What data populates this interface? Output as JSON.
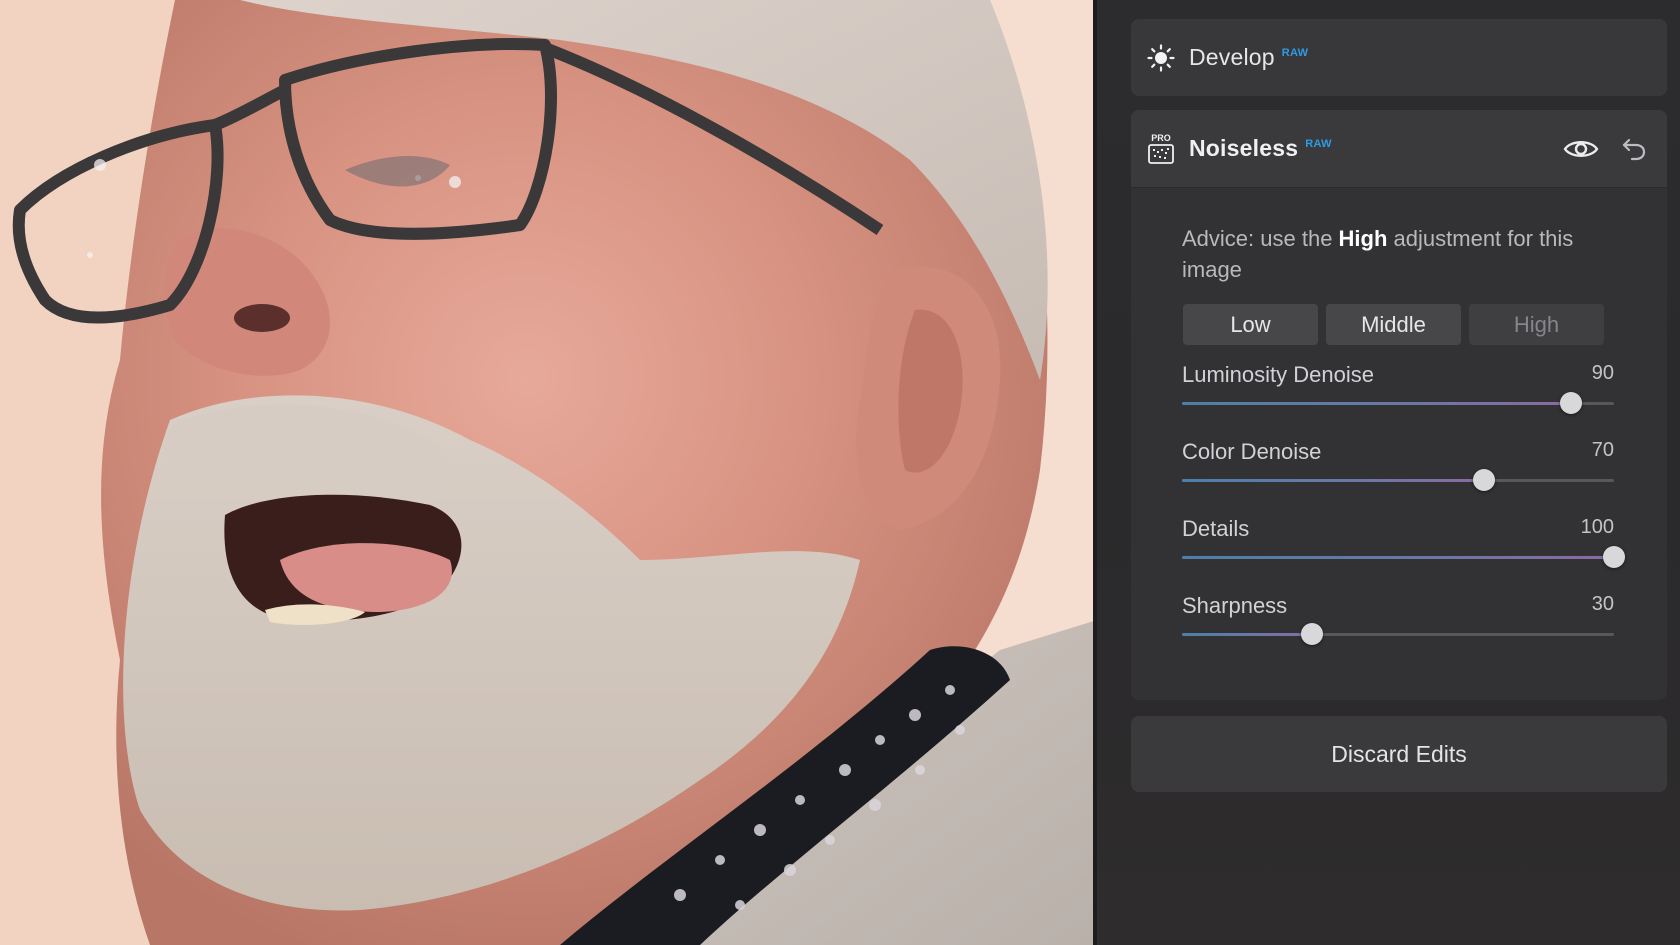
{
  "photo": {
    "alt": ""
  },
  "panel": {
    "develop": {
      "title": "Develop",
      "badge": "RAW",
      "icon": "sun-icon"
    },
    "noiseless": {
      "title": "Noiseless",
      "badge": "RAW",
      "icon_badge": "PRO",
      "icon": "noiseless-pro-icon",
      "visibility_icon": "eye-icon",
      "reset_icon": "undo-icon",
      "advice_prefix": "Advice: use the ",
      "advice_highlight": "High",
      "advice_suffix": " adjustment for this image",
      "presets": [
        {
          "label": "Low",
          "active": false
        },
        {
          "label": "Middle",
          "active": false
        },
        {
          "label": "High",
          "active": true
        }
      ],
      "sliders": [
        {
          "label": "Luminosity Denoise",
          "value": "90",
          "level": 90,
          "max": 100
        },
        {
          "label": "Color Denoise",
          "value": "70",
          "level": 70,
          "max": 100
        },
        {
          "label": "Details",
          "value": "100",
          "level": 100,
          "max": 100
        },
        {
          "label": "Sharpness",
          "value": "30",
          "level": 30,
          "max": 100
        }
      ]
    },
    "discard_label": "Discard Edits"
  },
  "colors": {
    "accent_raw": "#2f9be6",
    "panel_bg": "#2c2c2f",
    "card_bg": "#38383b"
  }
}
